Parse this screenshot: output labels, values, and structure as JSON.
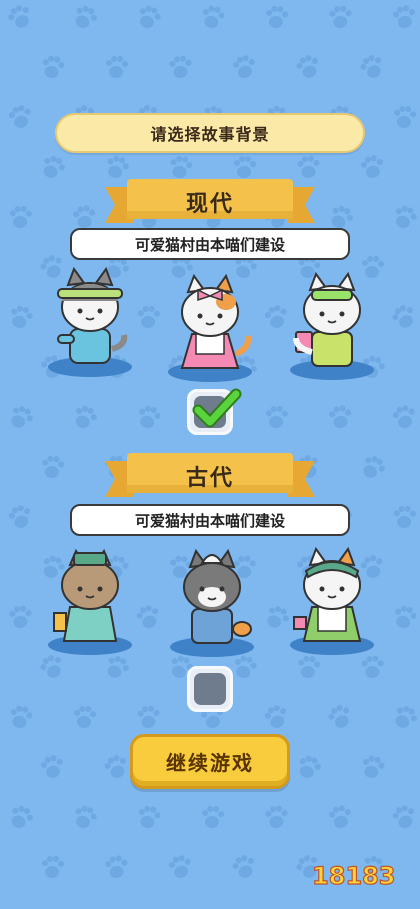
{
  "title": "请选择故事背景",
  "options": [
    {
      "era": "现代",
      "description": "可爱猫村由本喵们建设",
      "selected": true,
      "checkbox_icon": "checkmark-icon",
      "characters": [
        "cat-mechanic",
        "cat-pink-dress",
        "cat-sunglasses"
      ]
    },
    {
      "era": "古代",
      "description": "可爱猫村由本喵们建设",
      "selected": false,
      "checkbox_icon": "empty-box",
      "characters": [
        "cat-ancient-scholar",
        "cat-ancient-traveler",
        "cat-ancient-lady"
      ]
    }
  ],
  "continue_button": "继续游戏",
  "watermark": "18183",
  "colors": {
    "background": "#7fb7ef",
    "accent_yellow": "#f8cc3c",
    "ribbon": "#f4c24a",
    "checkmark_green": "#5ad33c"
  }
}
